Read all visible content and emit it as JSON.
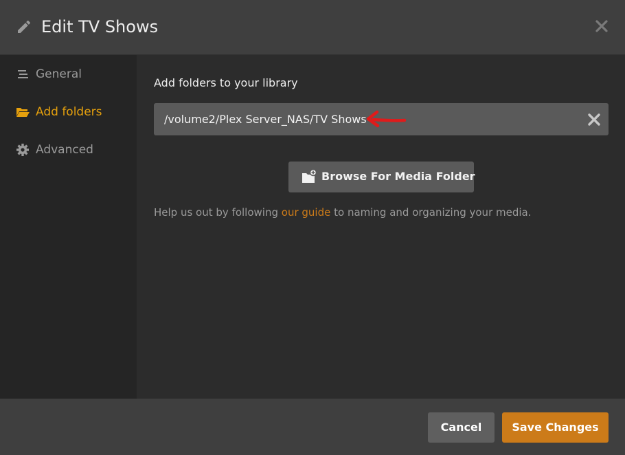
{
  "window": {
    "title": "Edit TV Shows",
    "title_icon": "pencil-icon",
    "close_icon": "close-icon"
  },
  "sidebar": {
    "active_index": 1,
    "items": [
      {
        "label": "General",
        "icon": "list-lines-icon"
      },
      {
        "label": "Add folders",
        "icon": "folder-open-icon"
      },
      {
        "label": "Advanced",
        "icon": "gear-icon"
      }
    ]
  },
  "main": {
    "section_title": "Add folders to your library",
    "folders": [
      {
        "path": "/volume2/Plex Server_NAS/TV Shows",
        "remove_icon": "close-icon"
      }
    ],
    "browse_button": {
      "label": "Browse For Media Folder",
      "icon": "add-folder-icon"
    },
    "help": {
      "before": "Help us out by following ",
      "link": "our guide",
      "after": " to naming and organizing your media."
    }
  },
  "footer": {
    "cancel_label": "Cancel",
    "save_label": "Save Changes"
  },
  "colors": {
    "accent": "#cc7b19",
    "active_nav": "#e5a00d",
    "annotation_arrow": "#e01b1b"
  }
}
